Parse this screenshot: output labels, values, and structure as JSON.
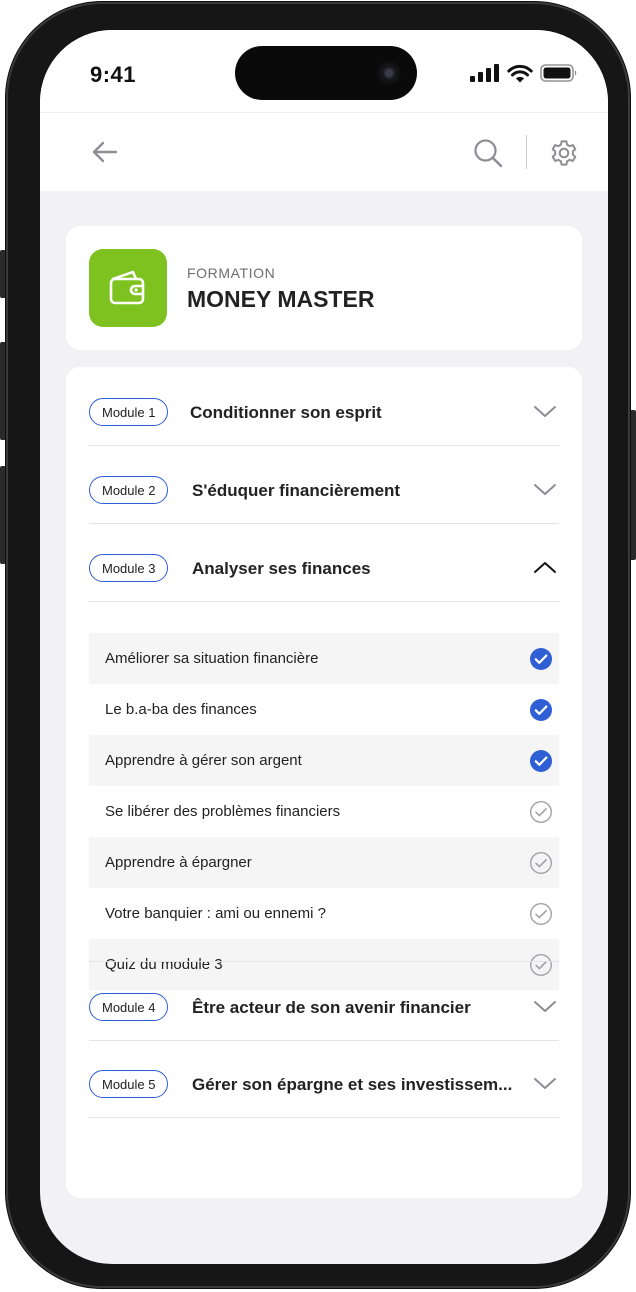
{
  "status_bar": {
    "time": "9:41"
  },
  "navbar": {
    "back_icon": "arrow-left-icon",
    "search_icon": "search-icon",
    "settings_icon": "gear-icon"
  },
  "header": {
    "icon": "wallet-icon",
    "icon_color": "#7dc21e",
    "eyebrow": "FORMATION",
    "title": "MONEY MASTER"
  },
  "accent_color": "#2f5fd4",
  "modules": [
    {
      "badge": "Module 1",
      "title": "Conditionner son esprit",
      "expanded": false
    },
    {
      "badge": "Module 2",
      "title": "S'éduquer financièrement",
      "expanded": false
    },
    {
      "badge": "Module 3",
      "title": "Analyser ses finances",
      "expanded": true
    },
    {
      "badge": "Module 4",
      "title": "Être acteur de son avenir financier",
      "expanded": false
    },
    {
      "badge": "Module 5",
      "title": "Gérer son épargne et ses investissem...",
      "expanded": false
    }
  ],
  "lessons": [
    {
      "label": "Améliorer sa situation financière",
      "completed": true
    },
    {
      "label": "Le b.a-ba des finances",
      "completed": true
    },
    {
      "label": "Apprendre à gérer son argent",
      "completed": true
    },
    {
      "label": "Se libérer des problèmes financiers",
      "completed": false
    },
    {
      "label": "Apprendre à épargner",
      "completed": false
    },
    {
      "label": "Votre banquier : ami ou ennemi ?",
      "completed": false
    },
    {
      "label": "Quiz du module 3",
      "completed": false
    }
  ]
}
